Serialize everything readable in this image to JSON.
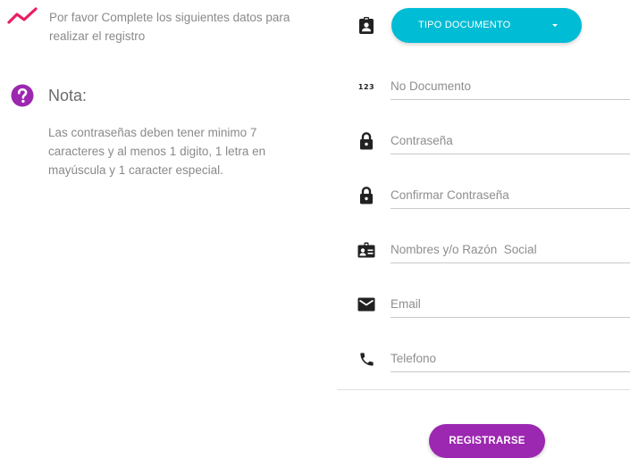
{
  "intro": {
    "icon": "trending-up-icon",
    "icon_color": "#e91e63",
    "text": "Por favor Complete los siguientes datos para realizar el registro"
  },
  "note": {
    "icon": "help-circle-icon",
    "icon_color": "#9c27b0",
    "title": "Nota:",
    "text": "Las contraseñas deben tener minimo 7 caracteres y al menos 1 digito, 1 letra en mayúscula y 1 caracter especial."
  },
  "form": {
    "document_type": {
      "icon": "clipboard-account-icon",
      "label": "TIPO DOCUMENTO",
      "color": "#00bcd4"
    },
    "fields": [
      {
        "icon": "numeric-icon",
        "icon_text": "123",
        "placeholder": "No Documento"
      },
      {
        "icon": "lock-icon",
        "placeholder": "Contraseña"
      },
      {
        "icon": "lock-icon",
        "placeholder": "Confirmar Contraseña"
      },
      {
        "icon": "account-box-icon",
        "placeholder": "Nombres y/o Razón  Social"
      },
      {
        "icon": "email-icon",
        "placeholder": "Email"
      },
      {
        "icon": "phone-icon",
        "placeholder": "Telefono"
      }
    ],
    "submit_label": "REGISTRARSE",
    "submit_color": "#9c27b0"
  }
}
